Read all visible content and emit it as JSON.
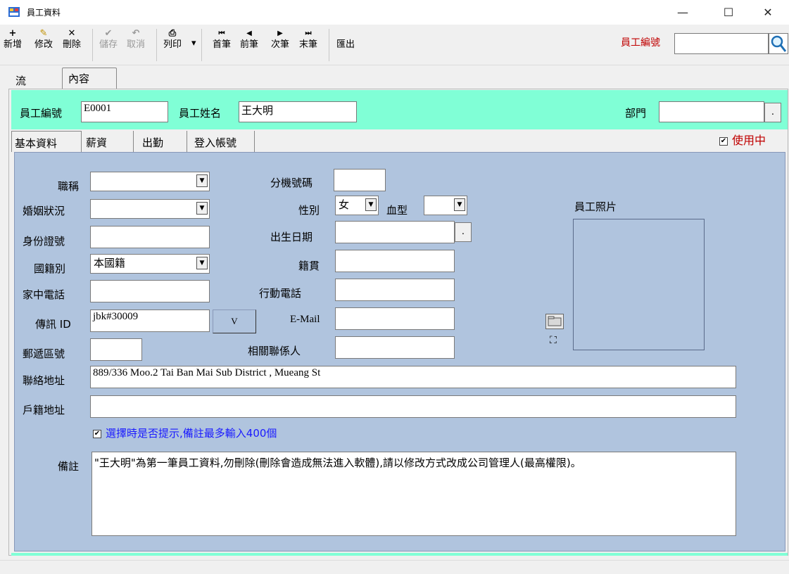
{
  "window": {
    "title": "員工資料",
    "minimize": "—",
    "maximize": "☐",
    "close": "✕"
  },
  "toolbar": {
    "add": {
      "icon": "+",
      "label": "新增"
    },
    "edit": {
      "icon": "✎",
      "label": "修改"
    },
    "delete": {
      "icon": "✕",
      "label": "刪除"
    },
    "save": {
      "icon": "✔",
      "label": "儲存"
    },
    "cancel": {
      "icon": "↶",
      "label": "取消"
    },
    "print": {
      "icon": "⎙",
      "label": "列印"
    },
    "first": {
      "icon": "⏮",
      "label": "首筆"
    },
    "prev": {
      "icon": "◀",
      "label": "前筆"
    },
    "next": {
      "icon": "▶",
      "label": "次筆"
    },
    "last": {
      "icon": "⏭",
      "label": "末筆"
    },
    "export": {
      "label": "匯出"
    }
  },
  "search": {
    "label": "員工編號",
    "value": ""
  },
  "outer_tabs": [
    "流覽",
    "內容"
  ],
  "header": {
    "emp_no_label": "員工編號",
    "emp_no": "E0001",
    "emp_name_label": "員工姓名",
    "emp_name": "王大明",
    "dept_label": "部門",
    "dept": "",
    "dept_btn": "."
  },
  "inner_tabs": [
    "基本資料",
    "薪資",
    "出勤",
    "登入帳號"
  ],
  "active_label": "使用中",
  "form": {
    "title_label": "職稱",
    "title": "",
    "marital_label": "婚姻狀況",
    "marital": "",
    "id_label": "身份證號",
    "id": "",
    "nationality_label": "國籍別",
    "nationality": "本國籍",
    "home_phone_label": "家中電話",
    "home_phone": "",
    "im_label": "傳訊 ID",
    "im": "jbk#30009",
    "v_btn": "V",
    "zip_label": "郵遞區號",
    "zip": "",
    "ext_label": "分機號碼",
    "ext": "",
    "gender_label": "性別",
    "gender": "女",
    "blood_label": "血型",
    "blood": "",
    "birth_label": "出生日期",
    "birth": "",
    "birth_btn": ".",
    "origin_label": "籍貫",
    "origin": "",
    "mobile_label": "行動電話",
    "mobile": "",
    "email_label": "E-Mail",
    "email": "",
    "contact_label": "相關聯係人",
    "contact": "",
    "photo_label": "員工照片",
    "address_label": "聯絡地址",
    "address": "889/336 Moo.2 Tai Ban Mai Sub District , Mueang St",
    "reg_address_label": "戶籍地址",
    "reg_address": "",
    "memo_check": "選擇時是否提示,備註最多輸入400個",
    "memo_label": "備註",
    "memo": "\"王大明\"為第一筆員工資料,勿刪除(刪除會造成無法進入軟體),請以修改方式改成公司管理人(最高權限)。"
  }
}
